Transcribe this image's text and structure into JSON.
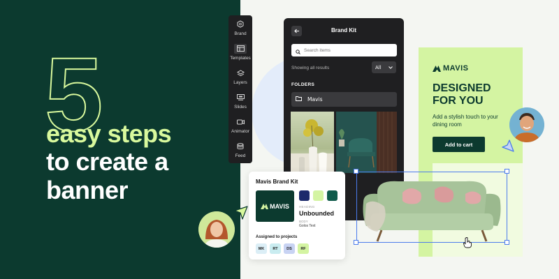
{
  "hero": {
    "number": "5",
    "line1": "easy steps",
    "line2": "to create a",
    "line3": "banner"
  },
  "sidebar": {
    "items": [
      {
        "label": "Brand",
        "icon": "hexagon-icon"
      },
      {
        "label": "Templates",
        "icon": "templates-icon"
      },
      {
        "label": "Layers",
        "icon": "layers-icon"
      },
      {
        "label": "Slides",
        "icon": "slides-icon"
      },
      {
        "label": "Animator",
        "icon": "video-camera-icon"
      },
      {
        "label": "Feed",
        "icon": "database-icon"
      }
    ],
    "active_index": 1
  },
  "brand_kit_panel": {
    "title": "Brand Kit",
    "search_placeholder": "Search items",
    "results_text": "Showing all results",
    "filter_value": "All",
    "folders_heading": "FOLDERS",
    "folder_name": "Mavis"
  },
  "brand_card": {
    "title": "Mavis Brand Kit",
    "logo_text": "MAVIS",
    "swatches": [
      "#1c2a6b",
      "#d4f4a2",
      "#0f5a4a"
    ],
    "heading_label": "HEADING",
    "heading_font": "Unbounded",
    "body_label": "BODY",
    "body_font": "Golos Text",
    "assigned_label": "Assigned to projects",
    "projects": [
      {
        "code": "MK",
        "color": "#dbeef6"
      },
      {
        "code": "RT",
        "color": "#c9ecf0"
      },
      {
        "code": "DS",
        "color": "#c8d3f3"
      },
      {
        "code": "RF",
        "color": "#d4f4a2"
      }
    ]
  },
  "banner": {
    "brand": "MAVIS",
    "headline_1": "DESIGNED",
    "headline_2": "FOR YOU",
    "subtext": "Add a stylish touch to your dining room",
    "cta": "Add to cart"
  },
  "colors": {
    "hero_bg": "#0c3a2f",
    "accent_lime": "#d9f99d",
    "panel_dark": "#1f1f21",
    "selection_blue": "#4b7bec"
  }
}
